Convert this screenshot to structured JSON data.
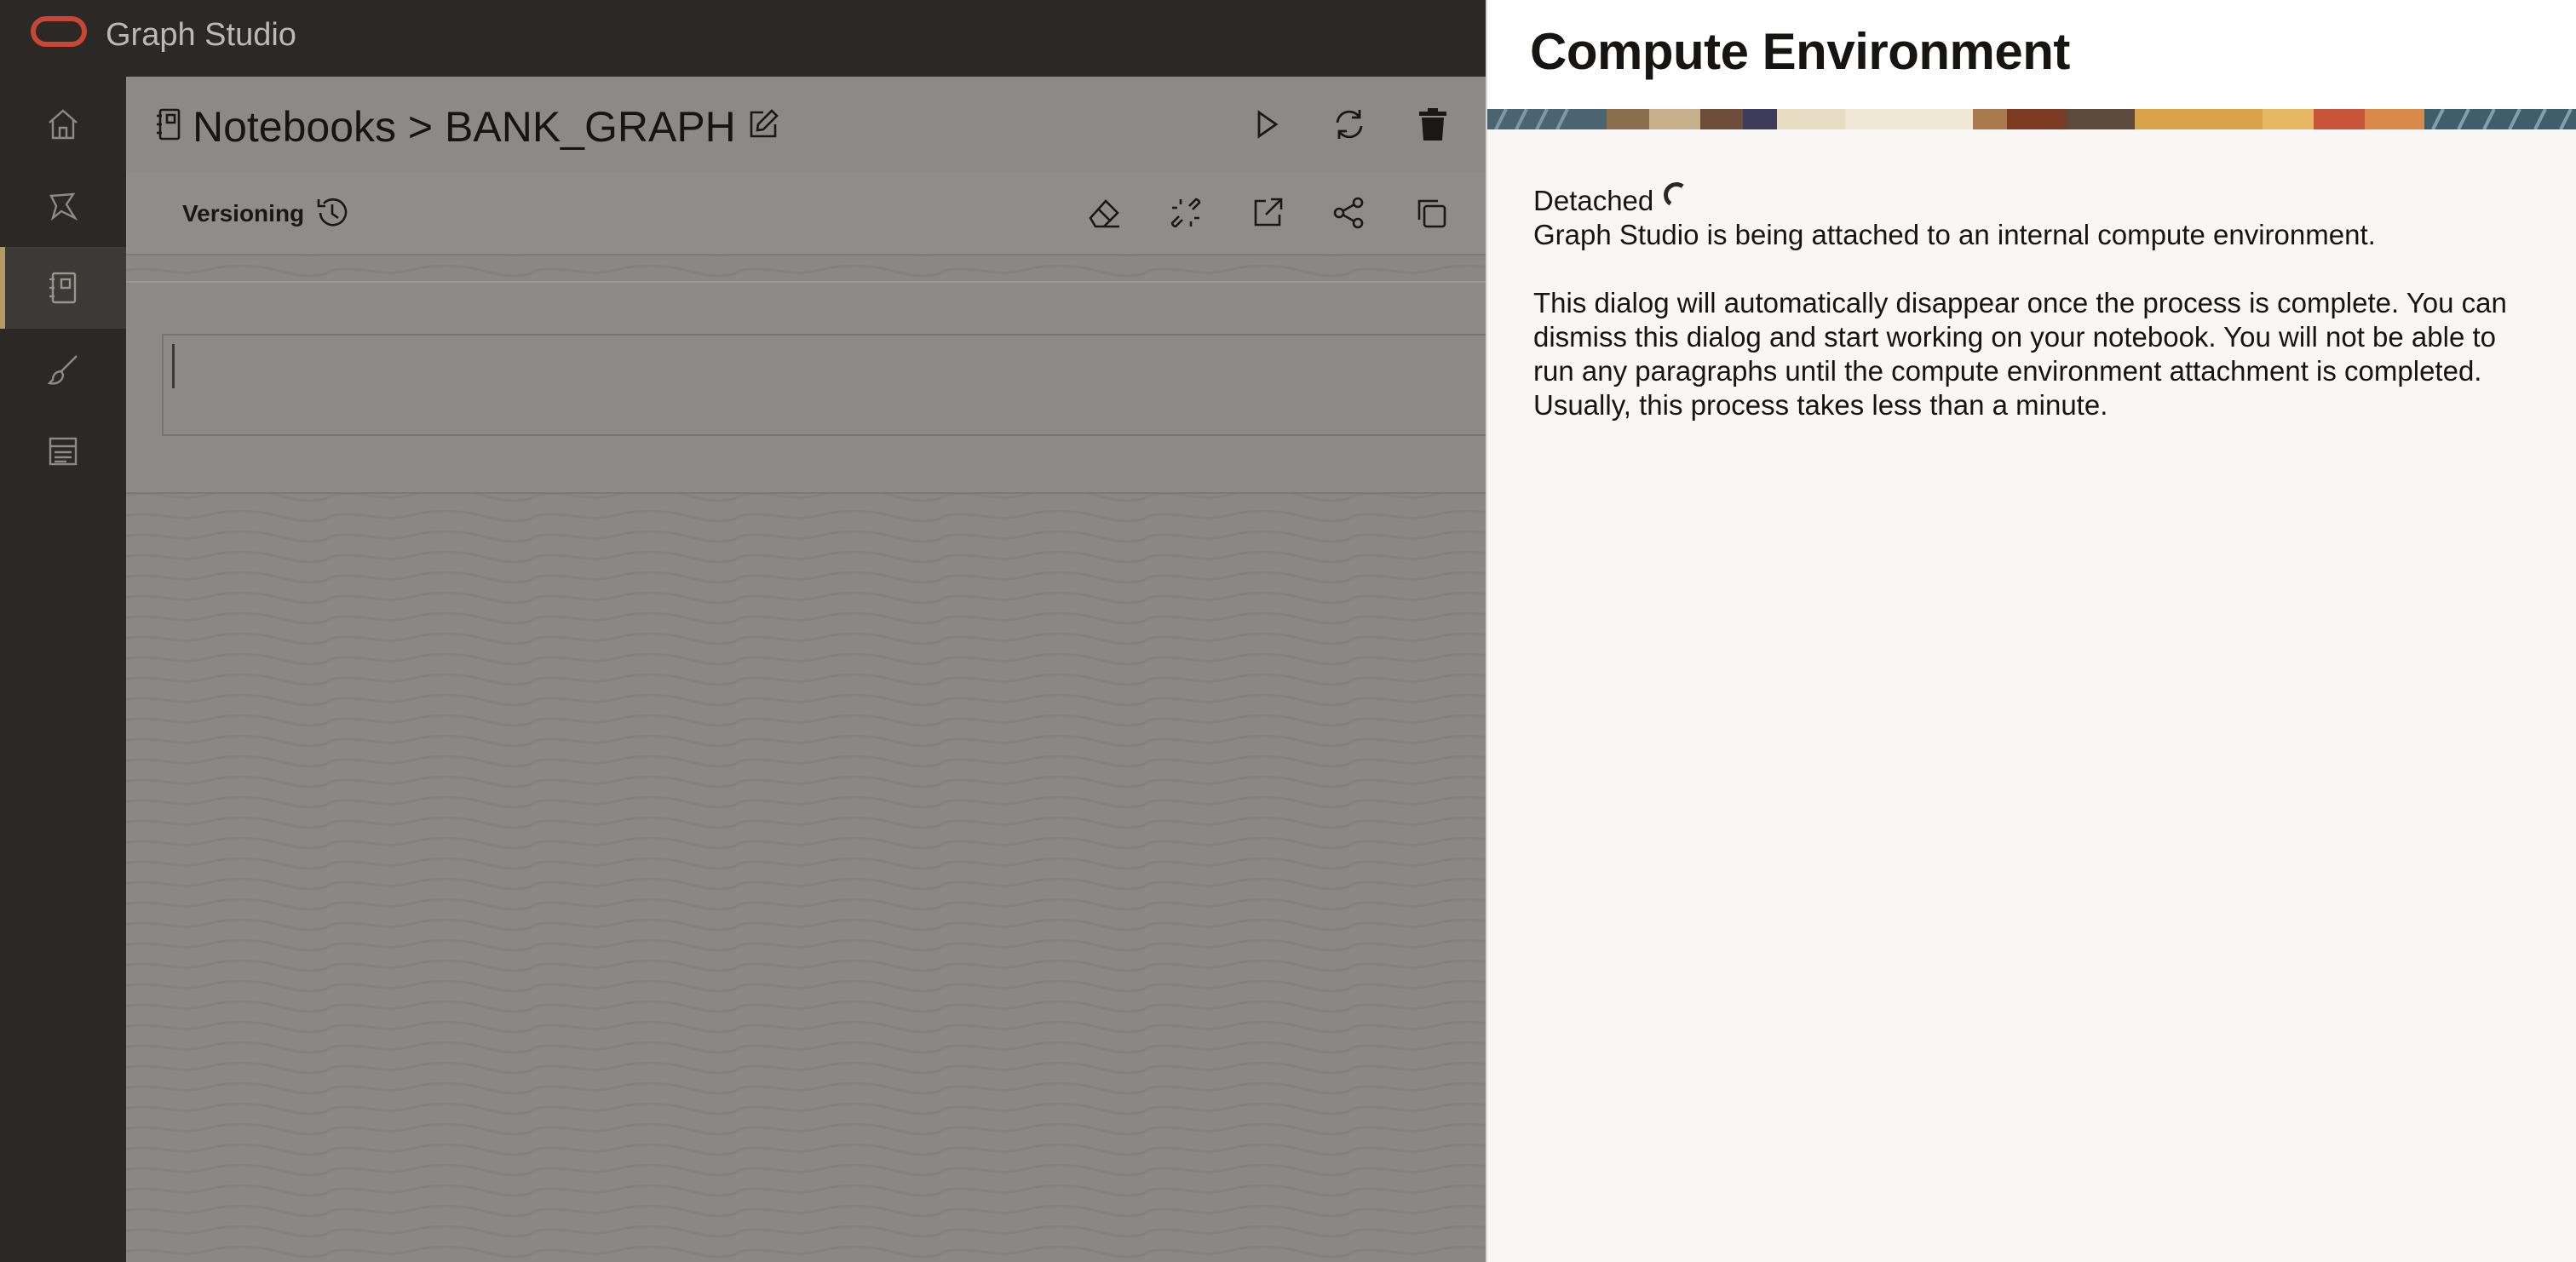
{
  "app": {
    "title": "Graph Studio",
    "brand_color": "#c74634"
  },
  "sidebar": {
    "items": [
      {
        "icon": "home-icon",
        "active": false
      },
      {
        "icon": "graph-icon",
        "active": false
      },
      {
        "icon": "notebook-icon",
        "active": true
      },
      {
        "icon": "brush-icon",
        "active": false
      },
      {
        "icon": "jobs-icon",
        "active": false
      }
    ],
    "active_color": "#b49a62"
  },
  "notebook": {
    "breadcrumb": "Notebooks > BANK_GRAPH",
    "header_actions": [
      "play-icon",
      "refresh-icon",
      "trash-icon"
    ],
    "toolbar": {
      "versioning_label": "Versioning",
      "actions": [
        "eraser-icon",
        "unlink-icon",
        "export-icon",
        "share-icon",
        "copy-icon"
      ]
    }
  },
  "panel": {
    "title": "Compute Environment",
    "status": "Detached",
    "message_1": "Graph Studio is being attached to an internal compute environment.",
    "message_2": "This dialog will automatically disappear once the process is complete. You can dismiss this dialog and start working on your notebook. You will not be able to run any paragraphs until the compute environment attachment is completed. Usually, this process takes less than a minute."
  }
}
